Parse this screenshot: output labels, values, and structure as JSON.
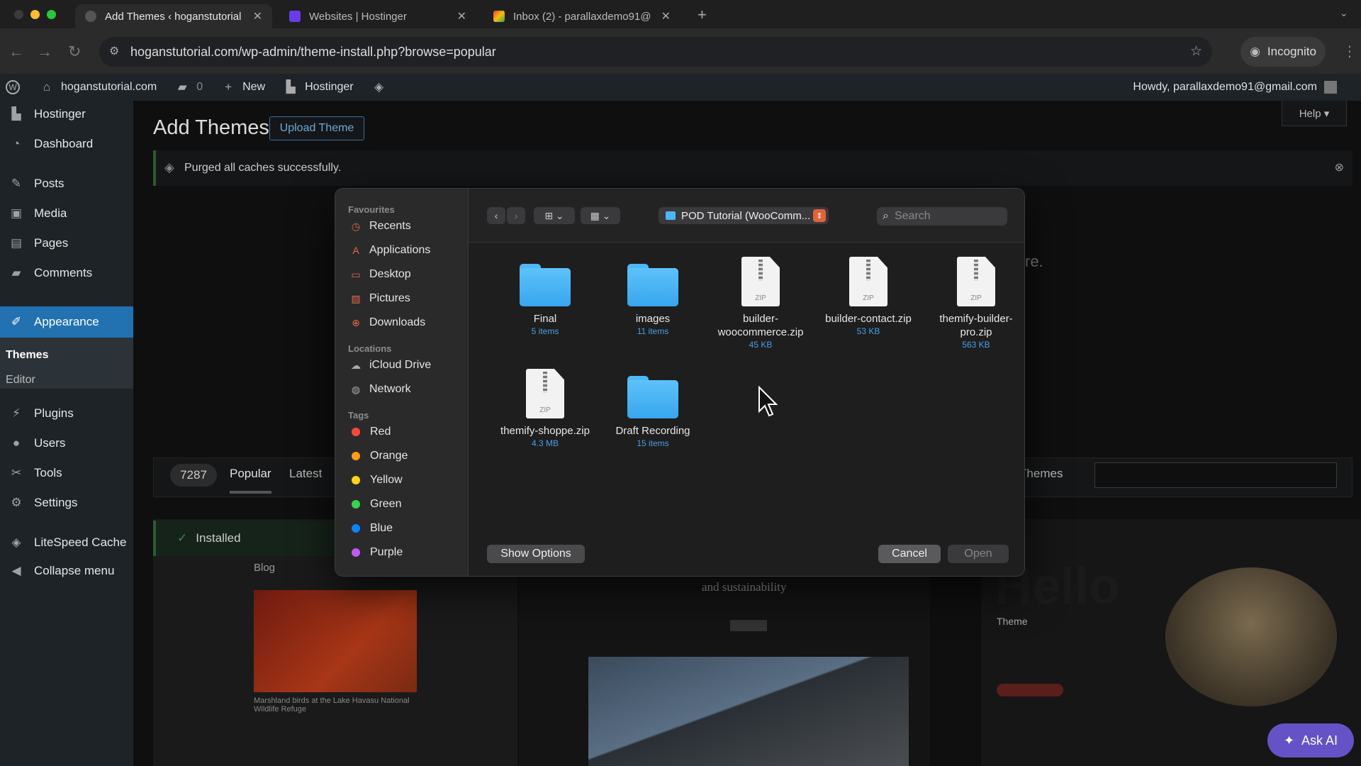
{
  "browser": {
    "tabs": [
      {
        "title": "Add Themes ‹ hoganstutorial",
        "favicon": "wordpress-icon",
        "active": true
      },
      {
        "title": "Websites | Hostinger",
        "favicon": "hostinger-icon",
        "active": false
      },
      {
        "title": "Inbox (2) - parallaxdemo91@",
        "favicon": "gmail-icon",
        "active": false
      }
    ],
    "url": "hoganstutorial.com/wp-admin/theme-install.php?browse=popular",
    "incognito_label": "Incognito"
  },
  "adminbar": {
    "site": "hoganstutorial.com",
    "comments": "0",
    "new": "New",
    "hostinger": "Hostinger",
    "howdy": "Howdy, parallaxdemo91@gmail.com"
  },
  "sidebar": {
    "items": [
      {
        "label": "Hostinger",
        "icon": "hostinger-icon"
      },
      {
        "label": "Dashboard",
        "icon": "dashboard-icon"
      },
      {
        "label": "Posts",
        "icon": "pin-icon"
      },
      {
        "label": "Media",
        "icon": "media-icon"
      },
      {
        "label": "Pages",
        "icon": "pages-icon"
      },
      {
        "label": "Comments",
        "icon": "comment-icon"
      },
      {
        "label": "Appearance",
        "icon": "brush-icon"
      },
      {
        "label": "Plugins",
        "icon": "plug-icon"
      },
      {
        "label": "Users",
        "icon": "user-icon"
      },
      {
        "label": "Tools",
        "icon": "wrench-icon"
      },
      {
        "label": "Settings",
        "icon": "settings-icon"
      },
      {
        "label": "LiteSpeed Cache",
        "icon": "diamond-icon"
      },
      {
        "label": "Collapse menu",
        "icon": "collapse-icon"
      }
    ],
    "sub": {
      "themes": "Themes",
      "editor": "Editor"
    }
  },
  "page": {
    "title": "Add Themes",
    "upload_button": "Upload Theme",
    "help": "Help ▾",
    "notice": "Purged all caches successfully.",
    "count": "7287",
    "tabs": [
      "Popular",
      "Latest"
    ],
    "search_label": "rch Themes",
    "installed": "Installed",
    "card1_label": "Blog",
    "card1_caption": "Marshland birds at the Lake Havasu National Wildlife Refuge",
    "card2_heading": "and sustainability",
    "card3_hello": "Hello",
    "card3_theme": "Theme",
    "ask_ai": "Ask AI",
    "bg_partial": "re."
  },
  "dialog": {
    "sections": {
      "favourites": "Favourites",
      "locations": "Locations",
      "tags": "Tags"
    },
    "favourites": [
      {
        "label": "Recents",
        "icon": "clock-icon"
      },
      {
        "label": "Applications",
        "icon": "applications-icon"
      },
      {
        "label": "Desktop",
        "icon": "desktop-icon"
      },
      {
        "label": "Pictures",
        "icon": "pictures-icon"
      },
      {
        "label": "Downloads",
        "icon": "download-icon"
      }
    ],
    "locations": [
      {
        "label": "iCloud Drive",
        "icon": "cloud-icon"
      },
      {
        "label": "Network",
        "icon": "globe-icon"
      }
    ],
    "tags": [
      {
        "label": "Red",
        "color": "#ff453a"
      },
      {
        "label": "Orange",
        "color": "#ff9f0a"
      },
      {
        "label": "Yellow",
        "color": "#ffd60a"
      },
      {
        "label": "Green",
        "color": "#32d74b"
      },
      {
        "label": "Blue",
        "color": "#0a84ff"
      },
      {
        "label": "Purple",
        "color": "#bf5af2"
      }
    ],
    "current_folder": "POD Tutorial (WooComm...",
    "search_placeholder": "Search",
    "files": [
      {
        "name": "Final",
        "sub": "5 items",
        "kind": "folder"
      },
      {
        "name": "images",
        "sub": "11 items",
        "kind": "folder"
      },
      {
        "name": "builder-woocommerce.zip",
        "sub": "45 KB",
        "kind": "zip"
      },
      {
        "name": "builder-contact.zip",
        "sub": "53 KB",
        "kind": "zip"
      },
      {
        "name": "themify-builder-pro.zip",
        "sub": "563 KB",
        "kind": "zip"
      },
      {
        "name": "themify-shoppe.zip",
        "sub": "4.3 MB",
        "kind": "zip"
      },
      {
        "name": "Draft Recording",
        "sub": "15 items",
        "kind": "folder"
      }
    ],
    "zip_badge": "ZIP",
    "show_options": "Show Options",
    "cancel": "Cancel",
    "open": "Open"
  }
}
